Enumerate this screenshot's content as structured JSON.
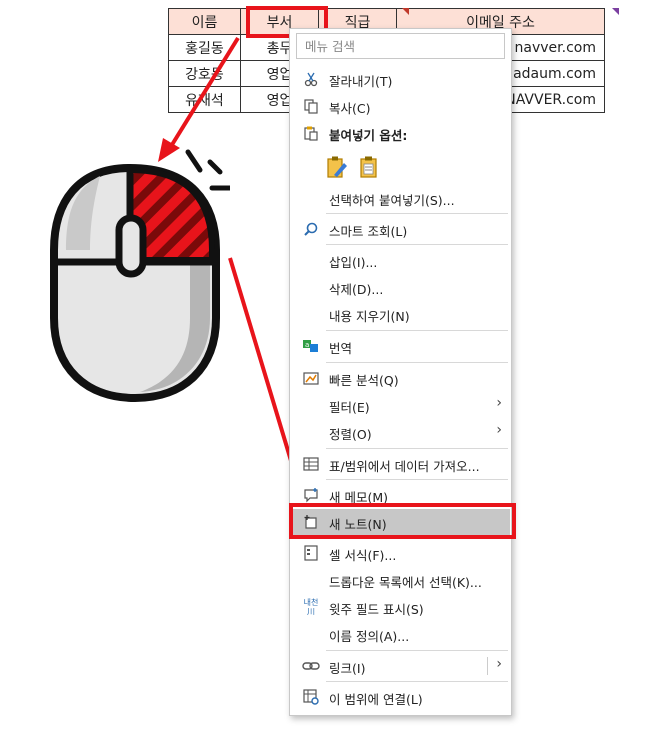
{
  "table": {
    "headers": [
      "이름",
      "부서",
      "직급",
      "이메일 주소"
    ],
    "rows": [
      [
        "홍길동",
        "총무",
        "",
        "navver.com"
      ],
      [
        "강호동",
        "영업",
        "",
        "dadaum.com"
      ],
      [
        "유재석",
        "영업",
        "",
        "NAVVER.com"
      ]
    ]
  },
  "menu": {
    "search_placeholder": "메뉴 검색",
    "cut": "잘라내기(T)",
    "copy": "복사(C)",
    "paste_options": "붙여넣기 옵션:",
    "paste_special": "선택하여 붙여넣기(S)...",
    "smart_lookup": "스마트 조회(L)",
    "insert": "삽입(I)...",
    "delete": "삭제(D)...",
    "clear_contents": "내용 지우기(N)",
    "translate": "번역",
    "quick_analysis": "빠른 분석(Q)",
    "filter": "필터(E)",
    "sort": "정렬(O)",
    "get_data": "표/범위에서 데이터 가져오...",
    "new_comment": "새 메모(M)",
    "new_note": "새 노트(N)",
    "format_cells": "셀 서식(F)...",
    "pick_from_list": "드롭다운 목록에서 선택(K)...",
    "phonetic": "윗주 필드 표시(S)",
    "define_name": "이름 정의(A)...",
    "link": "링크(I)",
    "link_to_range": "이 범위에 연결(L)",
    "phonetic_icon_top": "내천",
    "phonetic_icon_bottom": "川"
  },
  "colors": {
    "highlight_red": "#e8141b",
    "header_fill": "#fde0d6",
    "selected_item": "#c7c7c7"
  },
  "icons": {
    "cut": "scissors-icon",
    "copy": "copy-icon",
    "paste": "clipboard-icon",
    "smart_lookup": "search-icon",
    "translate": "translate-icon",
    "quick_analysis": "quick-analysis-icon",
    "get_data": "table-icon",
    "new_comment": "comment-icon",
    "new_note": "note-icon",
    "format_cells": "format-cells-icon",
    "phonetic": "phonetic-icon",
    "link": "link-icon",
    "link_to_range": "link-range-icon"
  }
}
